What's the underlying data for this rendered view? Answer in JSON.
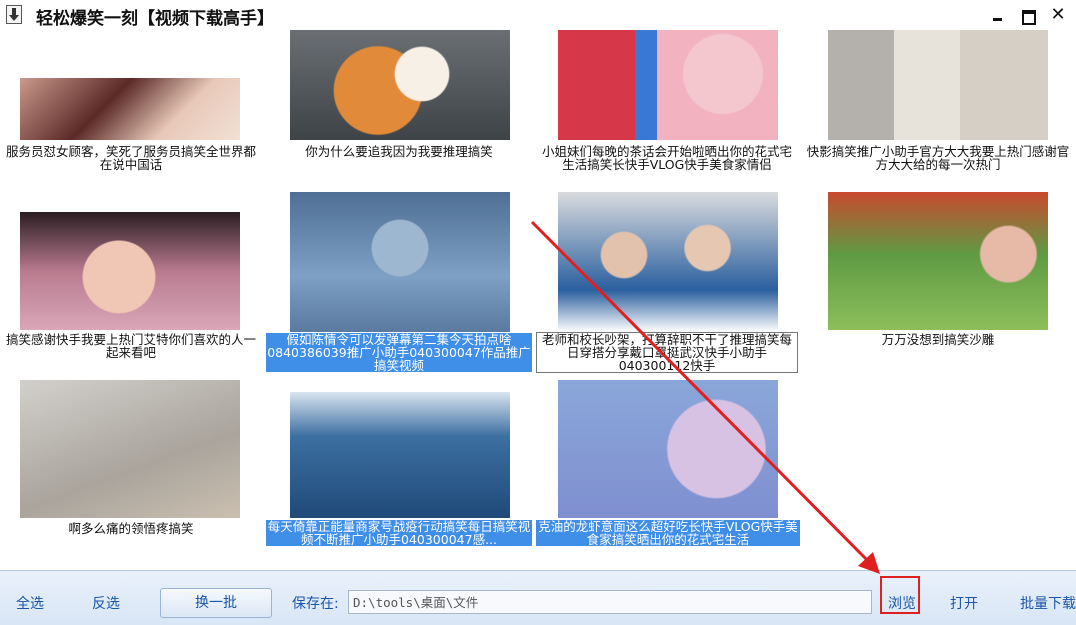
{
  "window": {
    "title": "轻松爆笑一刻【视频下载高手】",
    "controls": {
      "minimize": "–",
      "maximize": "□",
      "close": "✕"
    }
  },
  "videos": [
    {
      "caption": "服务员怼女顾客，笑死了服务员搞笑全世界都在说中国话",
      "selected": false
    },
    {
      "caption": "你为什么要追我因为我要推理搞笑",
      "selected": false
    },
    {
      "caption": "小姐妹们每晚的茶话会开始啦晒出你的花式宅生活搞笑长快手VLOG快手美食家情侣",
      "selected": false
    },
    {
      "caption": "快影搞笑推广小助手官方大大我要上热门感谢官方大大给的每一次热门",
      "selected": false
    },
    {
      "caption": "搞笑感谢快手我要上热门艾特你们喜欢的人一起来看吧",
      "selected": false
    },
    {
      "caption": "假如陈情令可以发弹幕第二集今天拍点啥0840386039推广小助手040300047作品推广搞笑视频",
      "selected": true
    },
    {
      "caption": "老师和校长吵架，打算辞职不干了推理搞笑每日穿搭分享戴口罩挺武汉快手小助手040300112快手",
      "selected": false,
      "bordered": true
    },
    {
      "caption": "万万没想到搞笑沙雕",
      "selected": false
    },
    {
      "caption": "啊多么痛的领悟疼搞笑",
      "selected": false
    },
    {
      "caption": "每天倚靠正能量商家号战疫行动搞笑每日搞笑视频不断推广小助手040300047感...",
      "selected": true
    },
    {
      "caption": "克油的龙虾意面这么超好吃长快手VLOG快手美食家搞笑晒出你的花式宅生活",
      "selected": true
    }
  ],
  "toolbar": {
    "select_all": "全选",
    "invert": "反选",
    "next_batch": "换一批",
    "save_to_label": "保存在:",
    "save_path": "D:\\tools\\桌面\\文件",
    "browse": "浏览",
    "open": "打开",
    "batch_download": "批量下载"
  },
  "colors": {
    "selection": "#3f8ee8",
    "link": "#1a55a8",
    "annotation": "#e02020"
  }
}
